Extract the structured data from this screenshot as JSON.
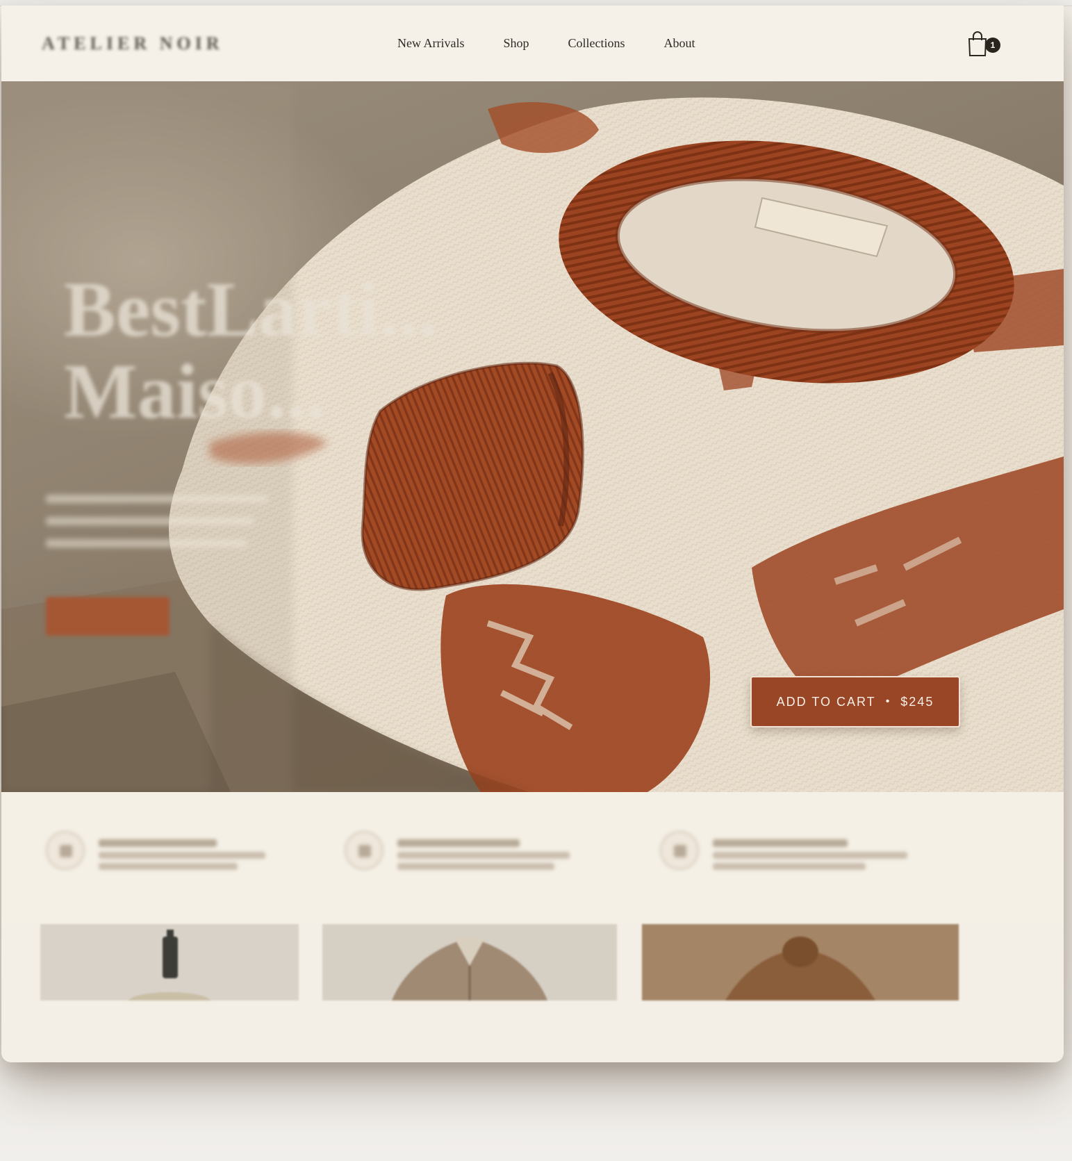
{
  "brand": {
    "logo_text": "ATELIER NOIR"
  },
  "nav": {
    "items": [
      "New Arrivals",
      "Shop",
      "Collections",
      "About"
    ]
  },
  "cart": {
    "count": "1",
    "icon": "shopping-bag-icon"
  },
  "hero": {
    "title_line1": "BestLarti...",
    "title_line2": "Maiso..."
  },
  "add_to_cart": {
    "label": "ADD TO CART",
    "separator": "•",
    "price": "$245"
  },
  "colors": {
    "accent": "#984625",
    "background": "#f4efe6",
    "text": "#2c2a27"
  }
}
